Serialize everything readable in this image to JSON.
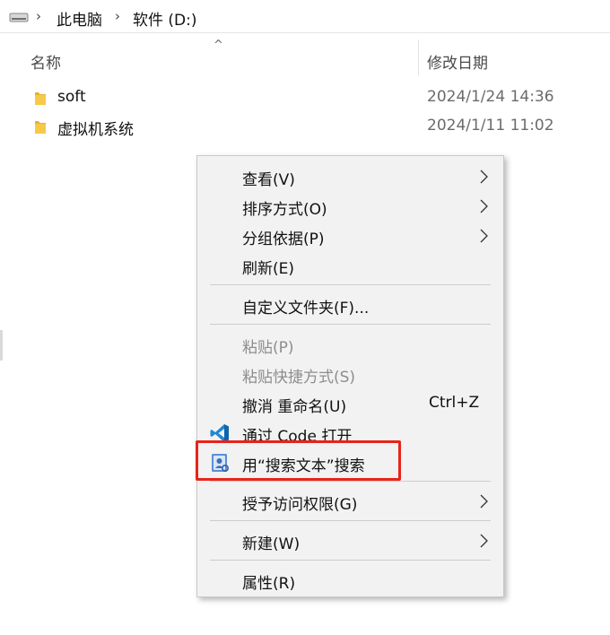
{
  "breadcrumb": {
    "items": [
      "此电脑",
      "软件 (D:)"
    ]
  },
  "columns": {
    "name": "名称",
    "date": "修改日期",
    "sort_indicator": "^"
  },
  "files": [
    {
      "name": "soft",
      "date": "2024/1/24 14:36",
      "icon": "folder-icon"
    },
    {
      "name": "虚拟机系统",
      "date": "2024/1/11 11:02",
      "icon": "folder-icon"
    }
  ],
  "context_menu": {
    "items": [
      {
        "label": "查看(V)",
        "submenu": true
      },
      {
        "label": "排序方式(O)",
        "submenu": true
      },
      {
        "label": "分组依据(P)",
        "submenu": true
      },
      {
        "label": "刷新(E)"
      },
      {
        "label": "自定义文件夹(F)..."
      },
      {
        "label": "粘贴(P)",
        "disabled": true
      },
      {
        "label": "粘贴快捷方式(S)",
        "disabled": true
      },
      {
        "label": "撤消 重命名(U)",
        "shortcut": "Ctrl+Z"
      },
      {
        "label": "通过 Code 打开",
        "icon": "vscode-icon"
      },
      {
        "label": "用“搜索文本”搜索",
        "icon": "search-text-app-icon"
      },
      {
        "label": "授予访问权限(G)",
        "submenu": true
      },
      {
        "label": "新建(W)",
        "submenu": true
      },
      {
        "label": "属性(R)"
      }
    ]
  },
  "colors": {
    "menu_bg": "#f2f2f2",
    "highlight_border": "#e8241a",
    "folder_yellow": "#f5c342",
    "vscode_blue": "#1f87d6"
  }
}
